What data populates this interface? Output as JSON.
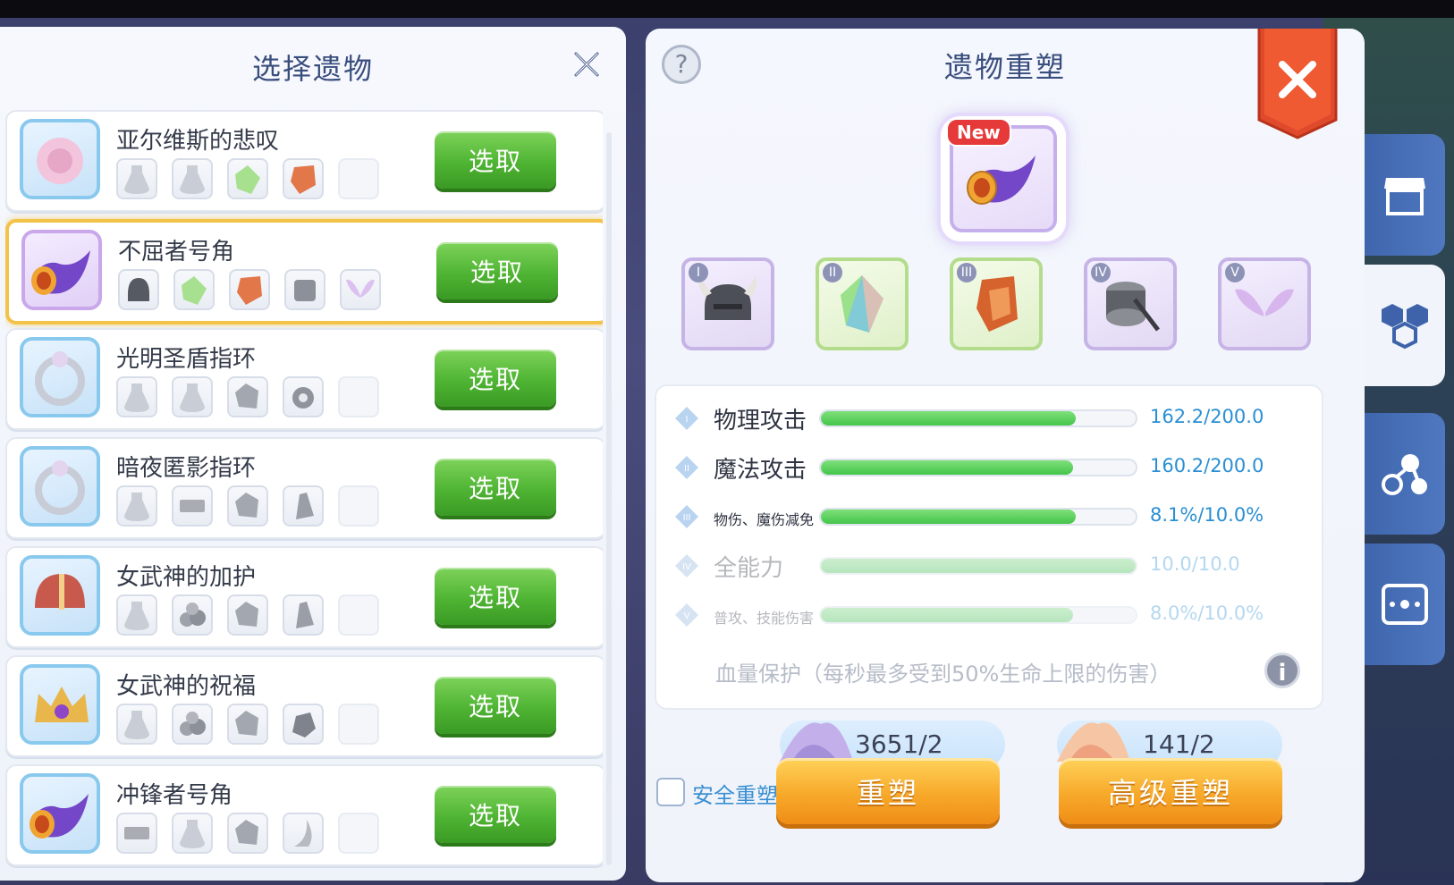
{
  "left_panel": {
    "title": "选择遗物",
    "items": [
      {
        "name": "亚尔维斯的悲叹",
        "button": "选取",
        "mats": [
          "potion-icon",
          "potion-icon",
          "gem-icon",
          "crystal-shard-icon",
          ""
        ],
        "icon": "flower-relic-icon"
      },
      {
        "name": "不屈者号角",
        "button": "选取",
        "mats": [
          "helmet-icon",
          "gem-icon",
          "crystal-shard-icon",
          "gear-spool-icon",
          "wings-icon"
        ],
        "icon": "horn-icon",
        "selected": true
      },
      {
        "name": "光明圣盾指环",
        "button": "选取",
        "mats": [
          "potion-icon",
          "potion-icon",
          "stone-icon",
          "cog-icon",
          ""
        ],
        "icon": "ring-icon"
      },
      {
        "name": "暗夜匿影指环",
        "button": "选取",
        "mats": [
          "potion-icon",
          "bar-icon",
          "stone-icon",
          "crystal-icon",
          ""
        ],
        "icon": "ring-icon"
      },
      {
        "name": "女武神的加护",
        "button": "选取",
        "mats": [
          "potion-icon",
          "rocks-icon",
          "stone-icon",
          "crystal-icon",
          ""
        ],
        "icon": "valkyrie-helmet-icon"
      },
      {
        "name": "女武神的祝福",
        "button": "选取",
        "mats": [
          "potion-icon",
          "rocks-icon",
          "stone-icon",
          "ore-icon",
          ""
        ],
        "icon": "valkyrie-crown-icon"
      },
      {
        "name": "冲锋者号角",
        "button": "选取",
        "mats": [
          "bar-icon",
          "potion-icon",
          "stone-icon",
          "claw-icon",
          ""
        ],
        "icon": "horn-icon"
      }
    ]
  },
  "right_panel": {
    "title": "遗物重塑",
    "new_badge": "New",
    "slot_numbers": [
      "I",
      "II",
      "III",
      "IV",
      "V"
    ],
    "stats": [
      {
        "num": "I",
        "label": "物理攻击",
        "value": "162.2/200.0",
        "fill": 0.81,
        "faded": false,
        "small": false
      },
      {
        "num": "II",
        "label": "魔法攻击",
        "value": "160.2/200.0",
        "fill": 0.8,
        "faded": false,
        "small": false
      },
      {
        "num": "III",
        "label": "物伤、魔伤减免",
        "value": "8.1%/10.0%",
        "fill": 0.81,
        "faded": false,
        "small": true
      },
      {
        "num": "IV",
        "label": "全能力",
        "value": "10.0/10.0",
        "fill": 1.0,
        "faded": true,
        "small": false
      },
      {
        "num": "V",
        "label": "普攻、技能伤害",
        "value": "8.0%/10.0%",
        "fill": 0.8,
        "faded": true,
        "small": true
      }
    ],
    "hp_note": "血量保护（每秒最多受到50%生命上限的伤害）",
    "cost_1": "3651/2",
    "cost_2": "141/2",
    "safe_label": "安全重塑",
    "reforge_button": "重塑",
    "advanced_button": "高级重塑"
  },
  "colors": {
    "accent_green": "#4fb433",
    "accent_orange": "#f7a92a",
    "stat_blue": "#2a8fd3",
    "ribbon_red": "#e04a2c"
  }
}
